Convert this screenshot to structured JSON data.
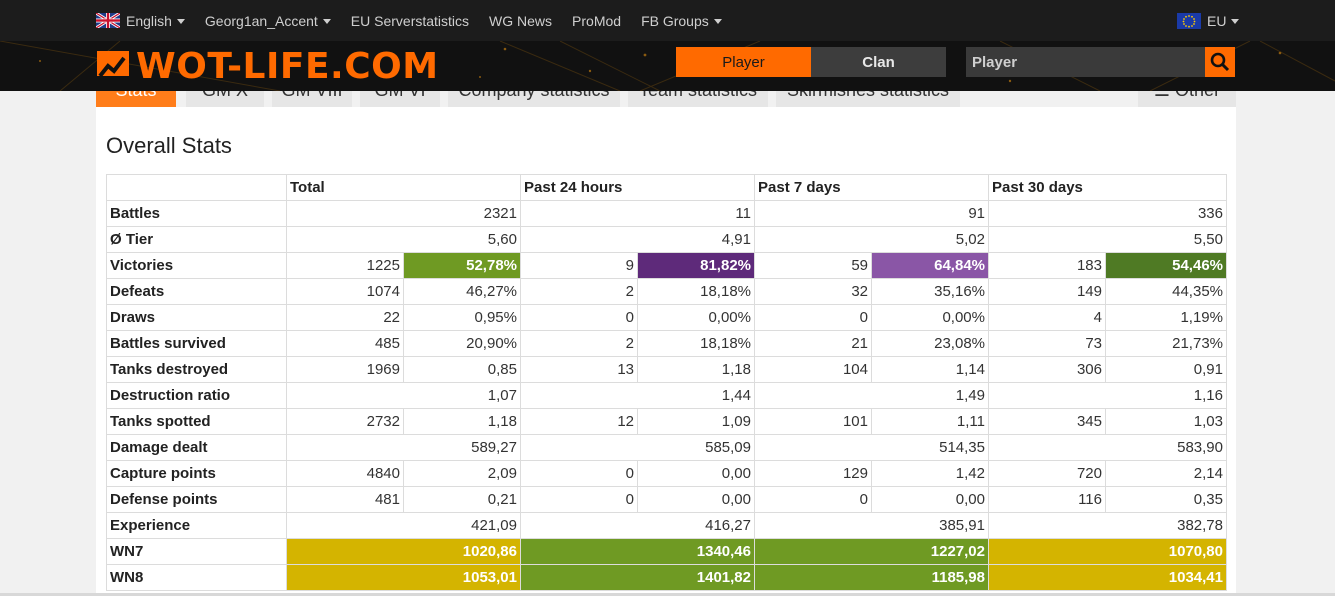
{
  "nav": {
    "language": "English",
    "user": "Georg1an_Accent",
    "links": [
      "EU Serverstatistics",
      "WG News",
      "ProMod"
    ],
    "groups": "FB Groups",
    "region": "EU"
  },
  "header": {
    "logo": "WOT-LIFE.COM",
    "player_button": "Player",
    "clan_button": "Clan",
    "search_placeholder": "Player"
  },
  "tabs": [
    "Stats",
    "GM X",
    "GM VIII",
    "GM VI",
    "Company statistics",
    "Team statistics",
    "Skirmishes statistics",
    "Other"
  ],
  "card": {
    "title": "Overall Stats"
  },
  "table": {
    "columns": [
      "Total",
      "Past 24 hours",
      "Past 7 days",
      "Past 30 days"
    ],
    "rows": [
      {
        "label": "Battles",
        "type": "single",
        "values": [
          "2321",
          "11",
          "91",
          "336"
        ]
      },
      {
        "label": "Ø Tier",
        "type": "single",
        "values": [
          "5,60",
          "4,91",
          "5,02",
          "5,50"
        ]
      },
      {
        "label": "Victories",
        "type": "pair",
        "values": [
          [
            "1225",
            "52,78%"
          ],
          [
            "9",
            "81,82%"
          ],
          [
            "59",
            "64,84%"
          ],
          [
            "183",
            "54,46%"
          ]
        ],
        "highlight": [
          "#6f9a23",
          "#5e2a7a",
          "#8a56a6",
          "#4f7a24"
        ]
      },
      {
        "label": "Defeats",
        "type": "pair",
        "values": [
          [
            "1074",
            "46,27%"
          ],
          [
            "2",
            "18,18%"
          ],
          [
            "32",
            "35,16%"
          ],
          [
            "149",
            "44,35%"
          ]
        ]
      },
      {
        "label": "Draws",
        "type": "pair",
        "values": [
          [
            "22",
            "0,95%"
          ],
          [
            "0",
            "0,00%"
          ],
          [
            "0",
            "0,00%"
          ],
          [
            "4",
            "1,19%"
          ]
        ]
      },
      {
        "label": "Battles survived",
        "type": "pair",
        "values": [
          [
            "485",
            "20,90%"
          ],
          [
            "2",
            "18,18%"
          ],
          [
            "21",
            "23,08%"
          ],
          [
            "73",
            "21,73%"
          ]
        ]
      },
      {
        "label": "Tanks destroyed",
        "type": "pair",
        "values": [
          [
            "1969",
            "0,85"
          ],
          [
            "13",
            "1,18"
          ],
          [
            "104",
            "1,14"
          ],
          [
            "306",
            "0,91"
          ]
        ]
      },
      {
        "label": "Destruction ratio",
        "type": "single",
        "values": [
          "1,07",
          "1,44",
          "1,49",
          "1,16"
        ]
      },
      {
        "label": "Tanks spotted",
        "type": "pair",
        "values": [
          [
            "2732",
            "1,18"
          ],
          [
            "12",
            "1,09"
          ],
          [
            "101",
            "1,11"
          ],
          [
            "345",
            "1,03"
          ]
        ]
      },
      {
        "label": "Damage dealt",
        "type": "single",
        "values": [
          "589,27",
          "585,09",
          "514,35",
          "583,90"
        ]
      },
      {
        "label": "Capture points",
        "type": "pair",
        "values": [
          [
            "4840",
            "2,09"
          ],
          [
            "0",
            "0,00"
          ],
          [
            "129",
            "1,42"
          ],
          [
            "720",
            "2,14"
          ]
        ]
      },
      {
        "label": "Defense points",
        "type": "pair",
        "values": [
          [
            "481",
            "0,21"
          ],
          [
            "0",
            "0,00"
          ],
          [
            "0",
            "0,00"
          ],
          [
            "116",
            "0,35"
          ]
        ]
      },
      {
        "label": "Experience",
        "type": "single",
        "values": [
          "421,09",
          "416,27",
          "385,91",
          "382,78"
        ]
      },
      {
        "label": "WN7",
        "type": "single",
        "values": [
          "1020,86",
          "1340,46",
          "1227,02",
          "1070,80"
        ],
        "highlight": [
          "#d4b400",
          "#6f9a23",
          "#6f9a23",
          "#d4b400"
        ]
      },
      {
        "label": "WN8",
        "type": "single",
        "values": [
          "1053,01",
          "1401,82",
          "1185,98",
          "1034,41"
        ],
        "highlight": [
          "#d4b400",
          "#6f9a23",
          "#6f9a23",
          "#d4b400"
        ]
      }
    ]
  },
  "colors": {
    "accent": "#ff6a00",
    "topbar": "#1c1c1c"
  }
}
